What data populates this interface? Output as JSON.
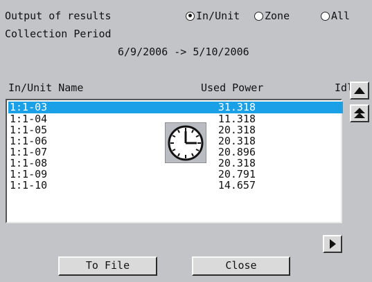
{
  "header": {
    "output_label": "Output of results",
    "period_label": "Collection Period",
    "period_range": "6/9/2006 -> 5/10/2006"
  },
  "radios": [
    {
      "label": "In/Unit",
      "selected": true
    },
    {
      "label": "Zone",
      "selected": false
    },
    {
      "label": "All",
      "selected": false
    }
  ],
  "columns": {
    "name": "In/Unit Name",
    "used_power": "Used Power",
    "idle": "Idl"
  },
  "rows": [
    {
      "name": "1:1-03",
      "power": "31.318",
      "selected": true
    },
    {
      "name": "1:1-04",
      "power": "11.318",
      "selected": false
    },
    {
      "name": "1:1-05",
      "power": "20.318",
      "selected": false
    },
    {
      "name": "1:1-06",
      "power": "20.318",
      "selected": false
    },
    {
      "name": "1:1-07",
      "power": "20.896",
      "selected": false
    },
    {
      "name": "1:1-08",
      "power": "20.318",
      "selected": false
    },
    {
      "name": "1:1-09",
      "power": "20.791",
      "selected": false
    },
    {
      "name": "1:1-10",
      "power": "14.657",
      "selected": false
    }
  ],
  "buttons": {
    "to_file": "To File",
    "close": "Close"
  },
  "icons": {
    "scroll_up": "triangle-up-icon",
    "scroll_top": "double-triangle-up-icon",
    "scroll_right": "triangle-right-icon",
    "busy": "clock-icon"
  },
  "colors": {
    "background": "#c2c4c8",
    "selection": "#1aa0e6"
  }
}
